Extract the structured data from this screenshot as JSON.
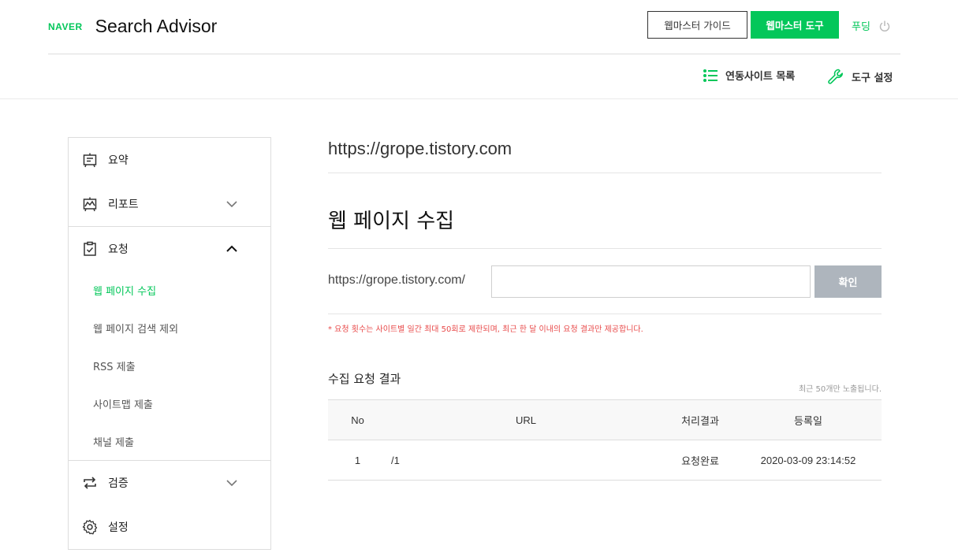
{
  "header": {
    "naver": "NAVER",
    "brand": "Search Advisor",
    "guide_button": "웹마스터 가이드",
    "tool_button": "웹마스터 도구",
    "user": "푸딩",
    "nav_sites": "연동사이트 목록",
    "nav_tools": "도구 설정",
    "accent_color": "#03c75a"
  },
  "sidebar": {
    "summary": "요약",
    "report": "리포트",
    "request": "요청",
    "sub_items": [
      "웹 페이지 수집",
      "웹 페이지 검색 제외",
      "RSS 제출",
      "사이트맵 제출",
      "채널 제출"
    ],
    "verify": "검증",
    "settings": "설정"
  },
  "main": {
    "site_url": "https://grope.tistory.com",
    "page_title": "웹 페이지 수집",
    "url_prefix": "https://grope.tistory.com/",
    "url_input_value": "",
    "confirm_button": "확인",
    "notice": "* 요청 횟수는 사이트별 일간 최대 50회로 제한되며, 최근 한 달 이내의 요청 결과만 제공합니다.",
    "result_title": "수집 요청 결과",
    "result_note": "최근 50개만 노출됩니다.",
    "table": {
      "headers": [
        "No",
        "URL",
        "처리결과",
        "등록일"
      ],
      "rows": [
        {
          "no": "1",
          "url": "/1",
          "result": "요청완료",
          "date": "2020-03-09 23:14:52"
        }
      ]
    }
  }
}
